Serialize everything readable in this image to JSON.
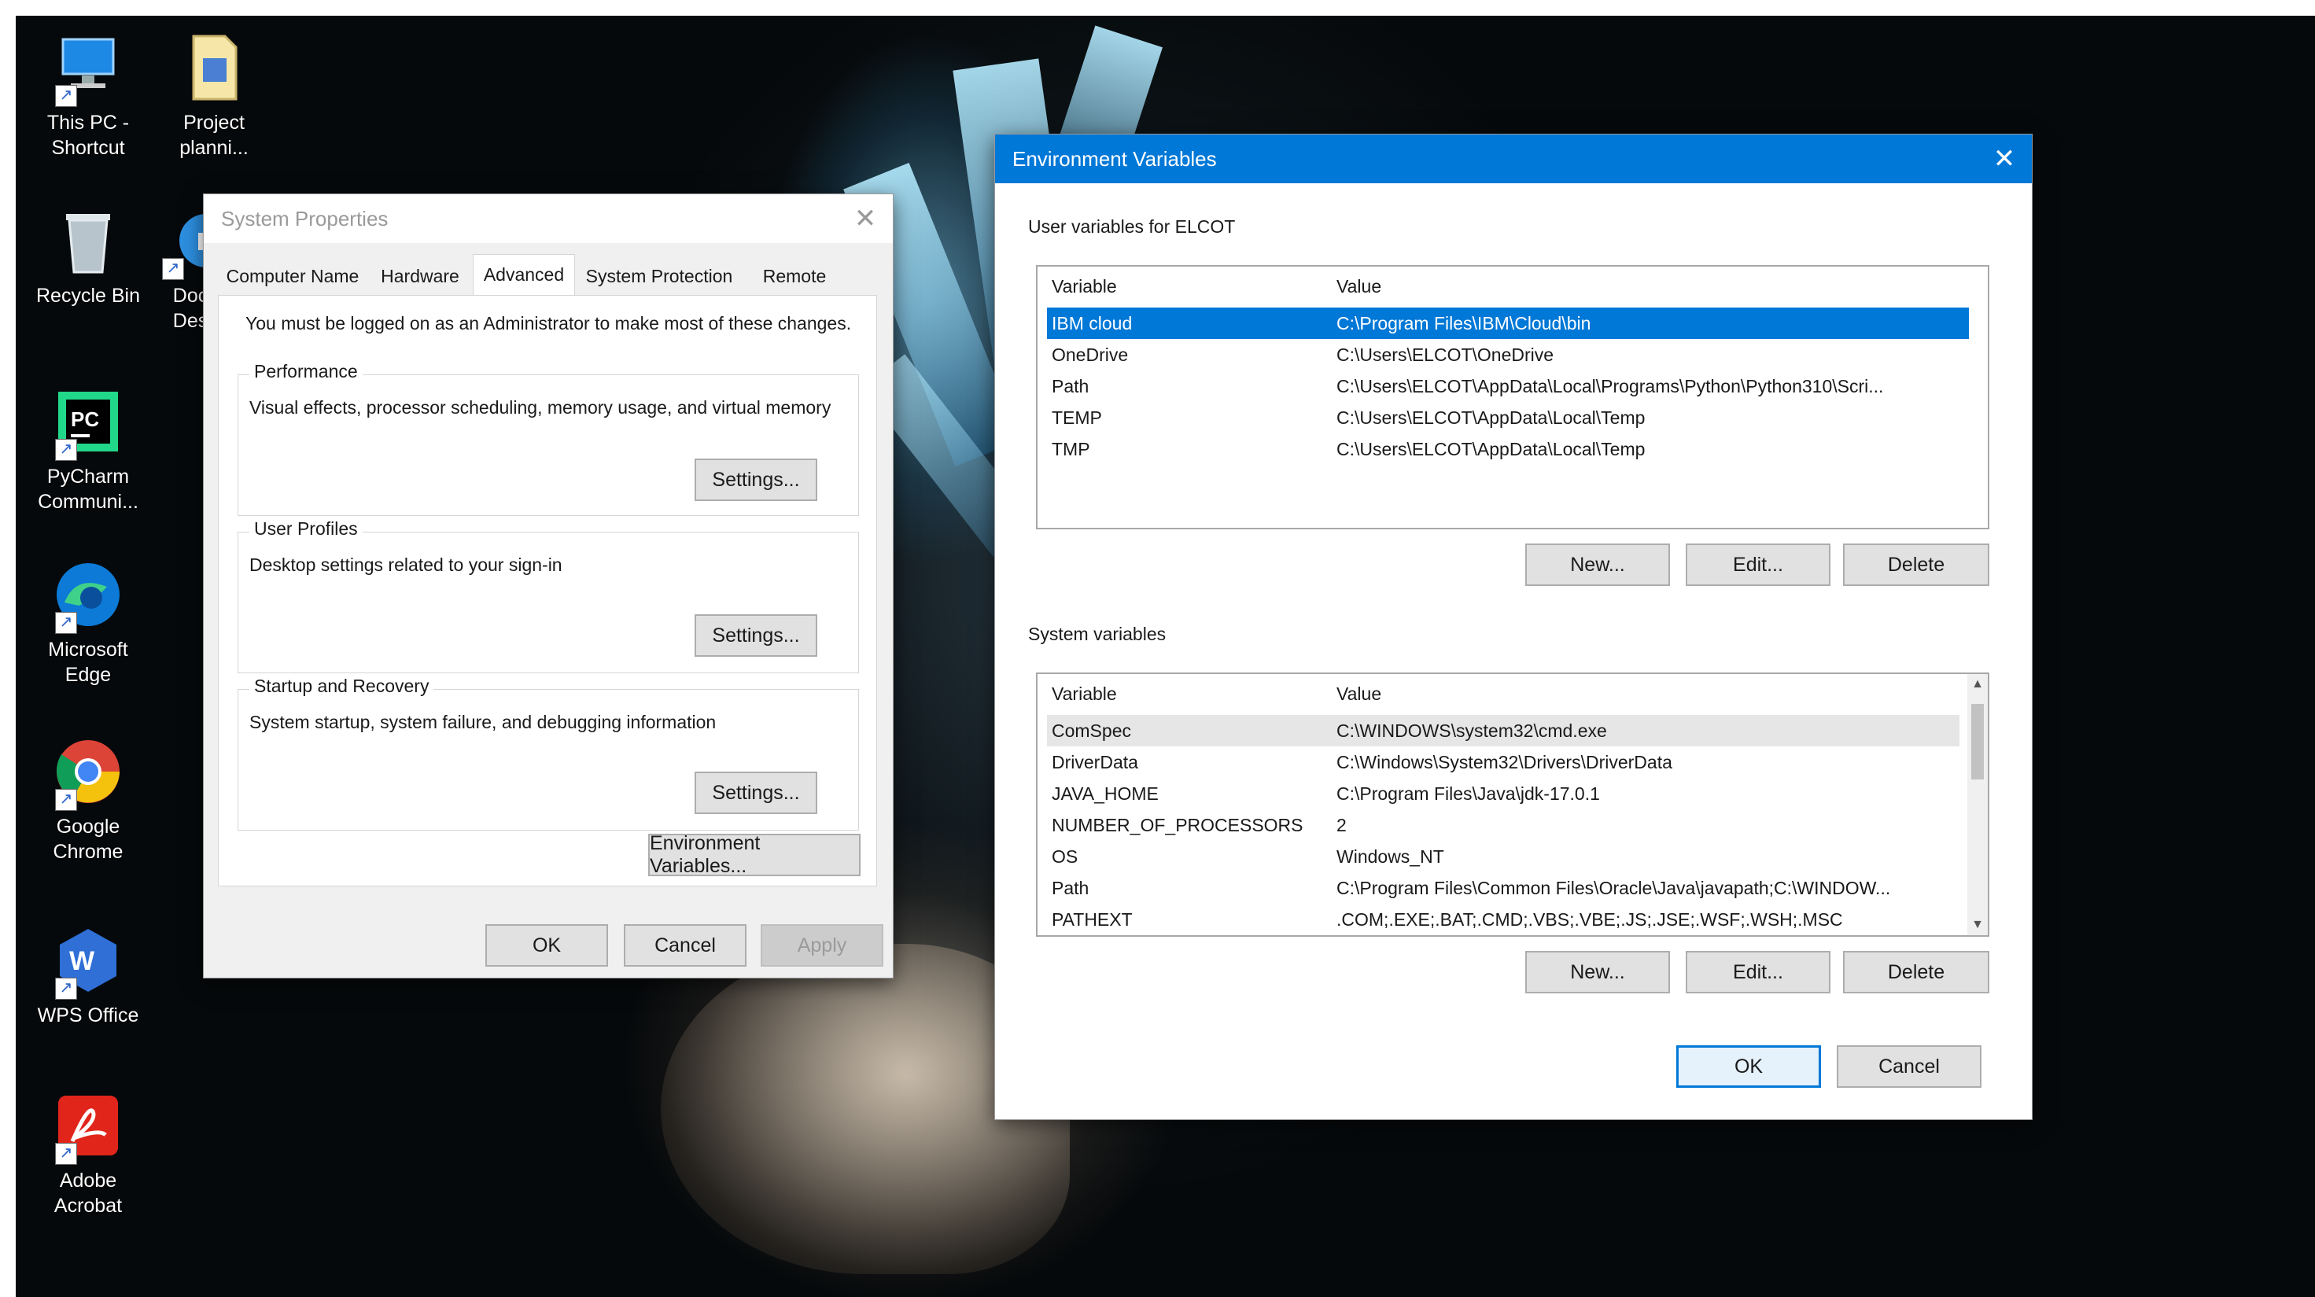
{
  "desktop_icons": [
    {
      "name": "this-pc-icon",
      "label": "This PC - Shortcut"
    },
    {
      "name": "project-file-icon",
      "label": "Project planni..."
    },
    {
      "name": "recycle-bin-icon",
      "label": "Recycle Bin"
    },
    {
      "name": "document-icon",
      "label": "Doc Des"
    },
    {
      "name": "pycharm-icon",
      "label": "PyCharm Communi..."
    },
    {
      "name": "edge-icon",
      "label": "Microsoft Edge"
    },
    {
      "name": "chrome-icon",
      "label": "Google Chrome"
    },
    {
      "name": "wps-office-icon",
      "label": "WPS Office"
    },
    {
      "name": "adobe-acrobat-icon",
      "label": "Adobe Acrobat"
    }
  ],
  "system_properties": {
    "title": "System Properties",
    "tabs": [
      "Computer Name",
      "Hardware",
      "Advanced",
      "System Protection",
      "Remote"
    ],
    "active_tab": "Advanced",
    "admin_note": "You must be logged on as an Administrator to make most of these changes.",
    "performance": {
      "title": "Performance",
      "desc": "Visual effects, processor scheduling, memory usage, and virtual memory",
      "button": "Settings..."
    },
    "user_profiles": {
      "title": "User Profiles",
      "desc": "Desktop settings related to your sign-in",
      "button": "Settings..."
    },
    "startup_recovery": {
      "title": "Startup and Recovery",
      "desc": "System startup, system failure, and debugging information",
      "button": "Settings..."
    },
    "env_button": "Environment Variables...",
    "ok": "OK",
    "cancel": "Cancel",
    "apply": "Apply"
  },
  "env_vars": {
    "title": "Environment Variables",
    "user_section": "User variables for ELCOT",
    "col_variable": "Variable",
    "col_value": "Value",
    "user_rows": [
      {
        "var": "IBM cloud",
        "value": "C:\\Program Files\\IBM\\Cloud\\bin"
      },
      {
        "var": "OneDrive",
        "value": "C:\\Users\\ELCOT\\OneDrive"
      },
      {
        "var": "Path",
        "value": "C:\\Users\\ELCOT\\AppData\\Local\\Programs\\Python\\Python310\\Scri..."
      },
      {
        "var": "TEMP",
        "value": "C:\\Users\\ELCOT\\AppData\\Local\\Temp"
      },
      {
        "var": "TMP",
        "value": "C:\\Users\\ELCOT\\AppData\\Local\\Temp"
      }
    ],
    "selected_user_row": "IBM cloud",
    "user_buttons": {
      "new": "New...",
      "edit": "Edit...",
      "delete": "Delete"
    },
    "system_section": "System variables",
    "system_rows": [
      {
        "var": "ComSpec",
        "value": "C:\\WINDOWS\\system32\\cmd.exe"
      },
      {
        "var": "DriverData",
        "value": "C:\\Windows\\System32\\Drivers\\DriverData"
      },
      {
        "var": "JAVA_HOME",
        "value": "C:\\Program Files\\Java\\jdk-17.0.1"
      },
      {
        "var": "NUMBER_OF_PROCESSORS",
        "value": "2"
      },
      {
        "var": "OS",
        "value": "Windows_NT"
      },
      {
        "var": "Path",
        "value": "C:\\Program Files\\Common Files\\Oracle\\Java\\javapath;C:\\WINDOW..."
      },
      {
        "var": "PATHEXT",
        "value": ".COM;.EXE;.BAT;.CMD;.VBS;.VBE;.JS;.JSE;.WSF;.WSH;.MSC"
      }
    ],
    "system_buttons": {
      "new": "New...",
      "edit": "Edit...",
      "delete": "Delete"
    },
    "ok": "OK",
    "cancel": "Cancel"
  },
  "colors": {
    "title_bar_active": "#0078d7",
    "selection": "#0078d7"
  }
}
